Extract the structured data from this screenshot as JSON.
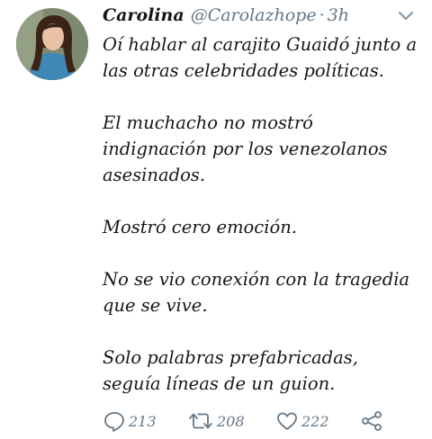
{
  "tweet": {
    "author": {
      "display_name": "Carolina",
      "handle": "@Carolazhope",
      "separator": "·",
      "time": "3h"
    },
    "paragraphs": [
      "Oí hablar al carajito Guaidó junto a las otras celebridades políticas.",
      "El muchacho no mostró indignación por los venezolanos asesinados.",
      "Mostró cero emoción.",
      "No se vio conexión con la tragedia que se vive.",
      "Solo palabras prefabricadas, seguía líneas de un guion."
    ],
    "actions": {
      "reply": {
        "icon": "reply-icon",
        "count": "213"
      },
      "retweet": {
        "icon": "retweet-icon",
        "count": "208"
      },
      "like": {
        "icon": "heart-icon",
        "count": "222"
      },
      "share": {
        "icon": "share-icon"
      }
    }
  },
  "colors": {
    "text": "#14171a",
    "secondary": "#657786",
    "background": "#ffffff"
  }
}
